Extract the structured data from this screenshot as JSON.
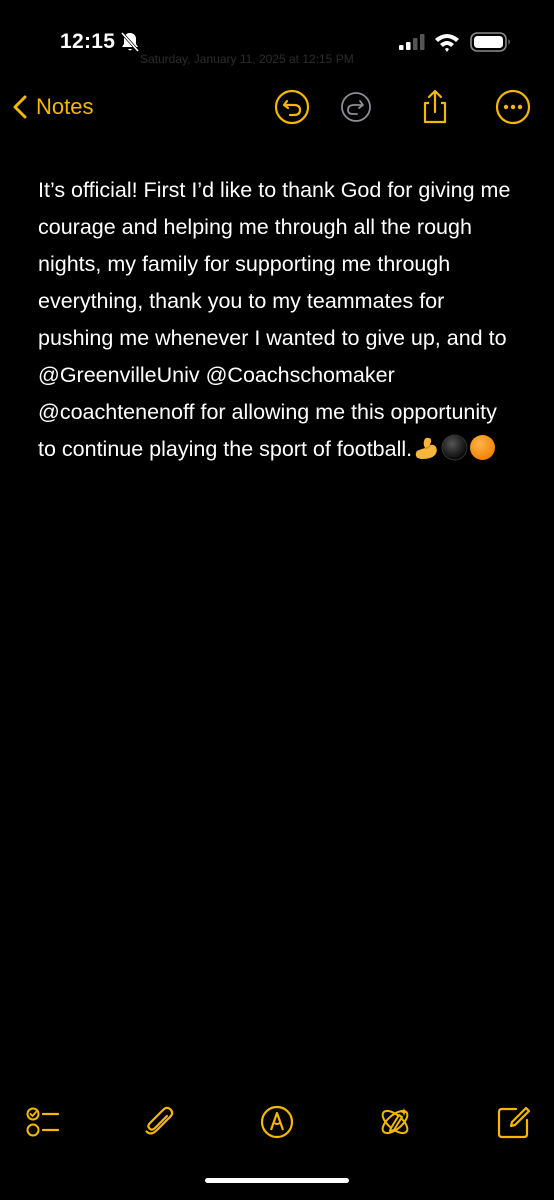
{
  "status_bar": {
    "time": "12:15",
    "ghost_text": "Saturday, January 11, 2025 at 12:15 PM",
    "icons": [
      "bell-slash-icon",
      "cellular-signal-icon",
      "wifi-icon",
      "battery-icon"
    ]
  },
  "nav": {
    "back_label": "Notes",
    "icons": [
      "undo-icon",
      "redo-icon",
      "share-icon",
      "more-icon"
    ]
  },
  "note": {
    "text": "It’s official! First I’d like to thank God for giving me courage and helping me through all the rough nights, my family for supporting me through everything, thank you to my teammates for pushing me whenever I wanted to give up, and to @GreenvilleUniv @Coachschomaker @coachtenenoff for allowing me this opportunity to continue playing the sport of football.",
    "emojis": [
      "flexed-biceps",
      "black-circle",
      "orange-circle"
    ]
  },
  "toolbar": {
    "icons": [
      "checklist-icon",
      "paperclip-icon",
      "markup-pen-icon",
      "writing-tools-icon",
      "compose-icon"
    ]
  },
  "colors": {
    "accent": "#f5b800",
    "background": "#000000",
    "text": "#ffffff",
    "disabled": "#8e8e93"
  }
}
